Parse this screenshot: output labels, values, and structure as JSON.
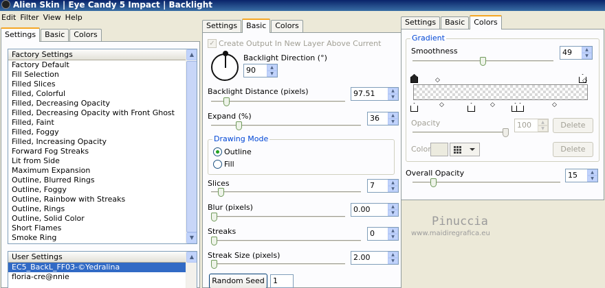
{
  "title": "Alien Skin | Eye Candy 5 Impact | Backlight",
  "menu": [
    "Edit",
    "Filter",
    "View",
    "Help"
  ],
  "left": {
    "tabs": [
      "Settings",
      "Basic",
      "Colors"
    ],
    "factory_header": "Factory Settings",
    "factory_items": [
      "Factory Default",
      "Fill Selection",
      "Filled Slices",
      "Filled, Colorful",
      "Filled, Decreasing Opacity",
      "Filled, Decreasing Opacity with Front Ghost",
      "Filled, Faint",
      "Filled, Foggy",
      "Filled, Increasing Opacity",
      "Forward Fog Streaks",
      "Lit from Side",
      "Maximum Expansion",
      "Outline, Blurred Rings",
      "Outline, Foggy",
      "Outline, Rainbow with Streaks",
      "Outline, Rings",
      "Outline, Solid Color",
      "Short Flames",
      "Smoke Ring"
    ],
    "user_header": "User Settings",
    "user_items": [
      "EC5_BackL_FF03-©Yedralina",
      "floria-cre@nnie"
    ]
  },
  "middle": {
    "tabs": [
      "Settings",
      "Basic",
      "Colors"
    ],
    "create_output_label": "Create Output In New Layer Above Current",
    "direction_label": "Backlight Direction (°)",
    "direction_value": "90",
    "distance_label": "Backlight Distance (pixels)",
    "distance_value": "97.51",
    "expand_label": "Expand (%)",
    "expand_value": "36",
    "drawing_mode_label": "Drawing Mode",
    "outline_label": "Outline",
    "fill_label": "Fill",
    "slices_label": "Slices",
    "slices_value": "7",
    "blur_label": "Blur (pixels)",
    "blur_value": "0.00",
    "streaks_label": "Streaks",
    "streaks_value": "0",
    "streak_size_label": "Streak Size (pixels)",
    "streak_size_value": "2.00",
    "random_seed_label": "Random Seed",
    "random_seed_value": "1"
  },
  "right": {
    "tabs": [
      "Settings",
      "Basic",
      "Colors"
    ],
    "gradient_label": "Gradient",
    "smoothness_label": "Smoothness",
    "smoothness_value": "49",
    "opacity_label": "Opacity",
    "opacity_value": "100",
    "delete_label": "Delete",
    "color_label": "Color",
    "overall_opacity_label": "Overall Opacity",
    "overall_opacity_value": "15"
  },
  "watermark": {
    "name": "Pinuccia",
    "url": "www.maidiregrafica.eu"
  },
  "colors": {
    "selection": "#316ac5",
    "group_legend": "#0046d5",
    "tab_highlight": "#f5a623"
  }
}
